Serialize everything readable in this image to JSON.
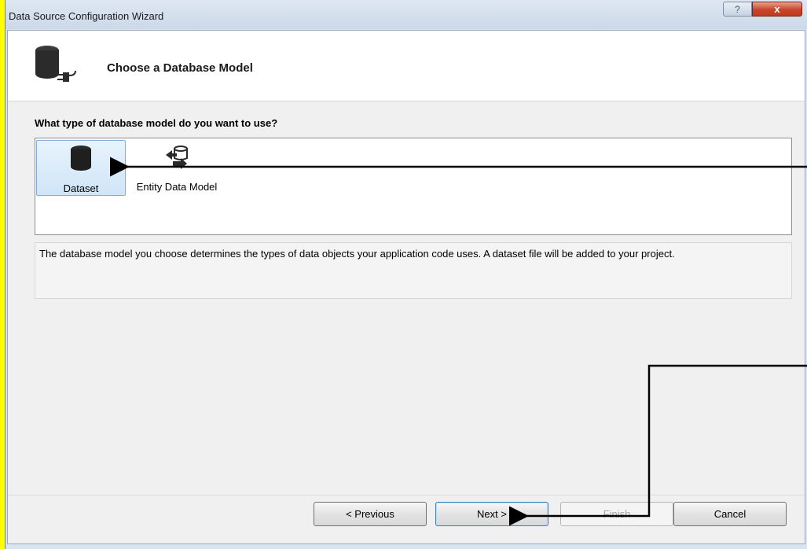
{
  "window": {
    "title": "Data Source Configuration Wizard",
    "help_label": "?",
    "close_label": "x"
  },
  "header": {
    "title": "Choose a Database Model",
    "icon": "database-plug-icon"
  },
  "question": "What type of database model do you want to use?",
  "models": [
    {
      "label": "Dataset",
      "icon": "database-icon",
      "selected": true
    },
    {
      "label": "Entity Data Model",
      "icon": "entity-data-model-icon",
      "selected": false
    }
  ],
  "description": "The database model you choose determines the types of data objects your application code uses. A dataset file will be added to your project.",
  "buttons": {
    "previous": "< Previous",
    "next": "Next >",
    "finish": "Finish",
    "cancel": "Cancel"
  },
  "colors": {
    "background_highlight": "#ffff00",
    "selection": "#cfe5f8",
    "close_button": "#c8452c"
  }
}
